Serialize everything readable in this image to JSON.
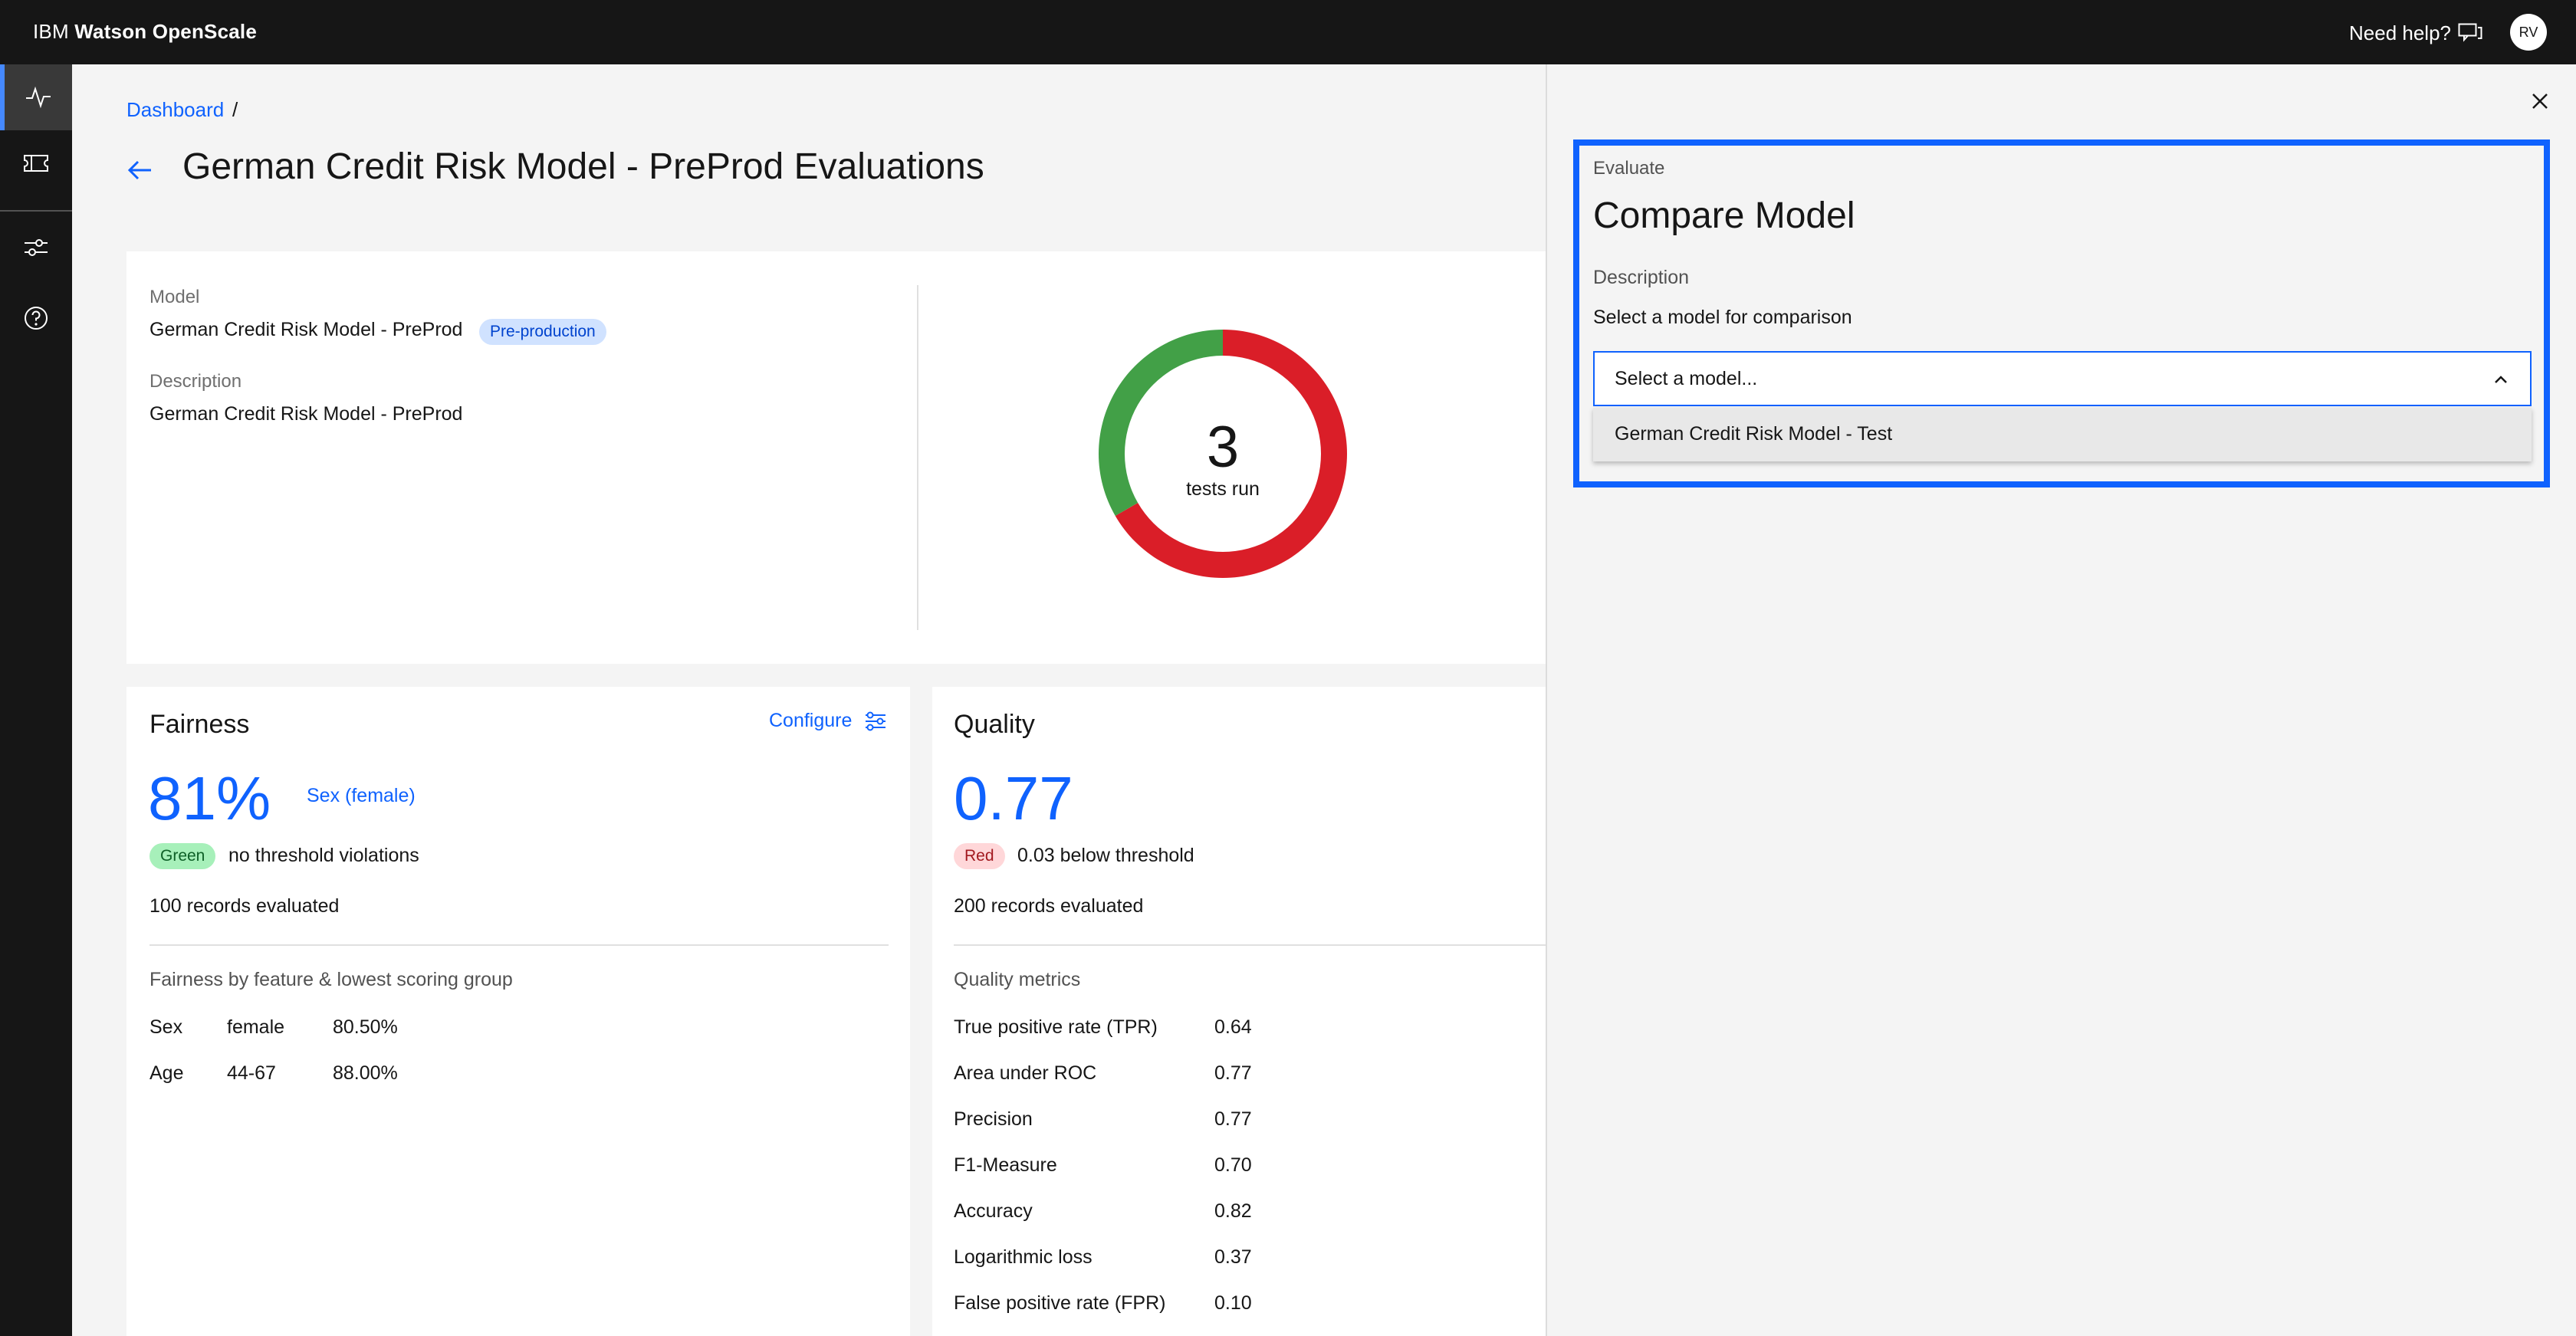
{
  "header": {
    "brand_prefix": "IBM",
    "brand_name": "Watson OpenScale",
    "help_label": "Need help?",
    "avatar_initials": "RV"
  },
  "rail": {
    "items": [
      {
        "icon": "activity-icon",
        "active": true
      },
      {
        "icon": "ticket-icon",
        "active": false
      },
      {
        "icon": "sliders-icon",
        "active": false
      },
      {
        "icon": "help-circle-icon",
        "active": false
      }
    ]
  },
  "breadcrumb": {
    "root": "Dashboard",
    "separator": "/"
  },
  "page": {
    "title": "German Credit Risk Model - PreProd Evaluations"
  },
  "summary": {
    "model_label": "Model",
    "model_name": "German Credit Risk Model - PreProd",
    "model_tag": "Pre-production",
    "description_label": "Description",
    "description": "German Credit Risk Model - PreProd",
    "tests_count": "3",
    "tests_label": "tests run",
    "donut": {
      "passed": 1,
      "failed": 2,
      "colors": {
        "passed": "#42a047",
        "failed": "#da1e28"
      }
    }
  },
  "fairness": {
    "title": "Fairness",
    "configure_label": "Configure",
    "score": "81%",
    "attribute_link": "Sex (female)",
    "status_tag": "Green",
    "status_text": "no threshold violations",
    "records": "100 records evaluated",
    "breakdown_label": "Fairness by feature & lowest scoring group",
    "rows": [
      {
        "feature": "Sex",
        "group": "female",
        "value": "80.50%"
      },
      {
        "feature": "Age",
        "group": "44-67",
        "value": "88.00%"
      }
    ]
  },
  "quality": {
    "title": "Quality",
    "score": "0.77",
    "status_tag": "Red",
    "status_text": "0.03 below threshold",
    "records": "200 records evaluated",
    "metrics_label": "Quality metrics",
    "metrics": [
      {
        "name": "True positive rate (TPR)",
        "value": "0.64"
      },
      {
        "name": "Area under ROC",
        "value": "0.77"
      },
      {
        "name": "Precision",
        "value": "0.77"
      },
      {
        "name": "F1-Measure",
        "value": "0.70"
      },
      {
        "name": "Accuracy",
        "value": "0.82"
      },
      {
        "name": "Logarithmic loss",
        "value": "0.37"
      },
      {
        "name": "False positive rate (FPR)",
        "value": "0.10"
      }
    ]
  },
  "panel": {
    "eyebrow": "Evaluate",
    "title": "Compare Model",
    "description_label": "Description",
    "description": "Select a model for comparison",
    "select_placeholder": "Select a model...",
    "options": [
      "German Credit Risk Model - Test"
    ]
  }
}
